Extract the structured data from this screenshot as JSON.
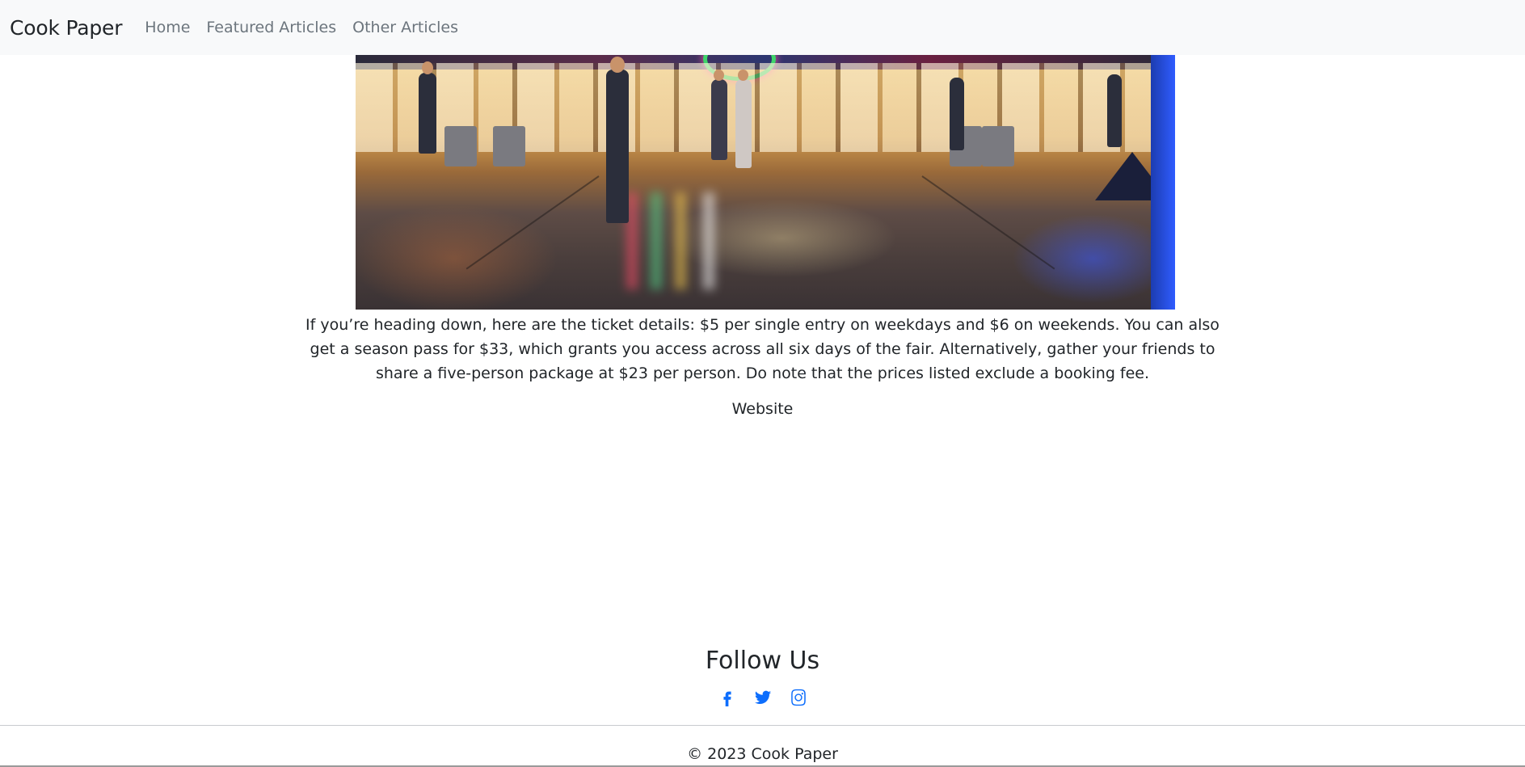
{
  "navbar": {
    "brand": "Cook Paper",
    "links": [
      {
        "label": "Home"
      },
      {
        "label": "Featured Articles"
      },
      {
        "label": "Other Articles"
      }
    ]
  },
  "hero": {
    "image_kind": "photo of an indoor fair with booths, shoppers and reflective floor"
  },
  "article": {
    "paragraph": "If you’re heading down, here are the ticket details: $5 per single entry on weekdays and $6 on weekends. You can also get a season pass for $33, which grants you access across all six days of the fair. Alternatively, gather your friends to share a five-person package at $23 per person. Do note that the prices listed exclude a booking fee.",
    "link_label": "Website"
  },
  "footer": {
    "follow_title": "Follow Us",
    "social_icons": [
      "facebook-icon",
      "twitter-icon",
      "instagram-icon"
    ],
    "copyright": "© 2023 Cook Paper"
  },
  "colors": {
    "navbar_bg": "#f8f9fa",
    "link_muted": "#6c757d",
    "text": "#212529",
    "social_accent": "#0d6efd"
  }
}
